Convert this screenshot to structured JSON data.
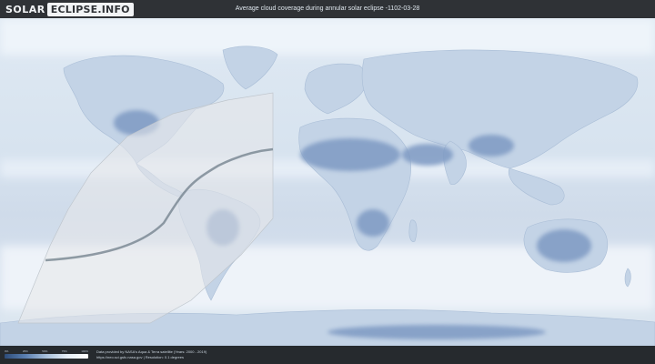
{
  "header": {
    "brand_solar": "SOLAR",
    "brand_eclipse": "ECLIPSE.INFO",
    "title": "Average cloud coverage during annular solar eclipse -1102-03-28"
  },
  "legend": {
    "ticks": [
      "0%",
      "25%",
      "50%",
      "75%",
      "100%"
    ],
    "colors": [
      "#2e4d7a",
      "#5b7fb0",
      "#a8c0db",
      "#e6eef6",
      "#ffffff"
    ]
  },
  "credits": {
    "line1": "Data provided by NASA's Aqua & Terra satellite (Years: 2000 - 2019)",
    "line2": "https://neo.sci.gsfc.nasa.gov | Resolution: 0.1 degrees"
  },
  "map": {
    "ocean_color": "#d7e3ef",
    "land_color": "#c9d7e7",
    "clear_sky_color": "#6e8fbd",
    "path_fill": "#e7e8ea",
    "centerline_color": "#6f7d89"
  }
}
